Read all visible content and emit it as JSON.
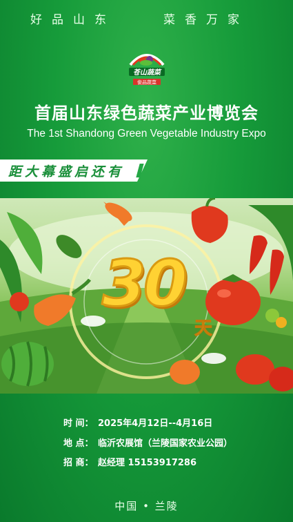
{
  "slogan": {
    "left": "好品山东",
    "right": "菜香万家"
  },
  "logo": {
    "name": "苍山蔬菜",
    "sub": "俊品蔬菜"
  },
  "title_cn": "首届山东绿色蔬菜产业博览会",
  "title_en": "The 1st Shandong Green Vegetable Industry Expo",
  "countdown": {
    "label": "距大幕盛启还有",
    "days": "30",
    "unit": "天"
  },
  "info": [
    {
      "label": "时 间：",
      "value": "2025年4月12日--4月16日"
    },
    {
      "label": "地 点：",
      "value": "临沂农展馆（兰陵国家农业公园）"
    },
    {
      "label": "招 商：",
      "value": "赵经理  15153917286"
    }
  ],
  "footer": "中国 • 兰陵",
  "colors": {
    "bg_green": "#169b3a",
    "accent_yellow": "#ffd233",
    "vegetable_red": "#e0391e"
  }
}
